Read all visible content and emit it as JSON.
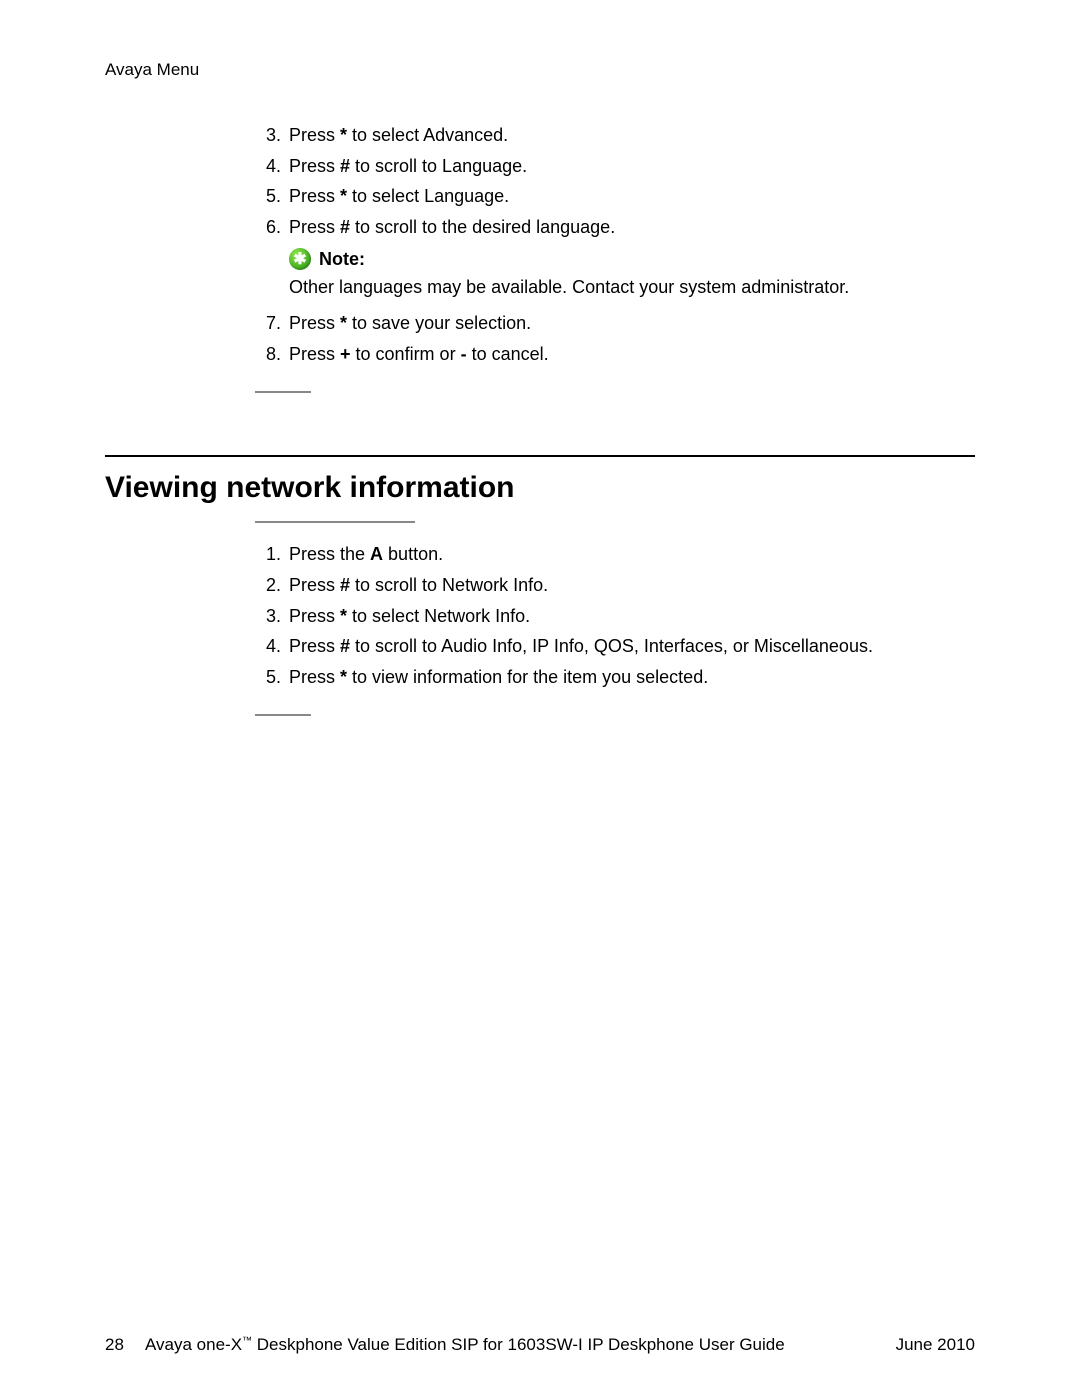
{
  "header": {
    "breadcrumb": "Avaya Menu"
  },
  "steps1": [
    {
      "n": "3.",
      "pre": "Press ",
      "key": "*",
      "post": " to select Advanced."
    },
    {
      "n": "4.",
      "pre": "Press ",
      "key": "#",
      "post": " to scroll to Language."
    },
    {
      "n": "5.",
      "pre": "Press ",
      "key": "*",
      "post": " to select Language."
    },
    {
      "n": "6.",
      "pre": "Press ",
      "key": "#",
      "post": " to scroll to the desired language."
    }
  ],
  "note": {
    "icon_glyph": "✱",
    "label": "Note:",
    "body": "Other languages may be available. Contact your system administrator."
  },
  "steps1b": [
    {
      "n": "7.",
      "pre": "Press ",
      "key": "*",
      "post": " to save your selection."
    },
    {
      "n": "8.",
      "pre": "Press ",
      "key": "+",
      "post": " to confirm or ",
      "key2": "-",
      "post2": " to cancel."
    }
  ],
  "section": {
    "title": "Viewing network information"
  },
  "steps2": [
    {
      "n": "1.",
      "pre": "Press the ",
      "key": "A",
      "post": " button."
    },
    {
      "n": "2.",
      "pre": "Press ",
      "key": "#",
      "post": " to scroll to Network Info."
    },
    {
      "n": "3.",
      "pre": "Press ",
      "key": "*",
      "post": " to select Network Info."
    },
    {
      "n": "4.",
      "pre": "Press ",
      "key": "#",
      "post": " to scroll to Audio Info, IP Info, QOS, Interfaces, or Miscellaneous."
    },
    {
      "n": "5.",
      "pre": "Press ",
      "key": "*",
      "post": " to view information for the item you selected."
    }
  ],
  "footer": {
    "page": "28",
    "doc_pre": "Avaya one-X",
    "tm": "™",
    "doc_post": " Deskphone Value Edition SIP for 1603SW-I IP Deskphone User Guide",
    "date": "June 2010"
  }
}
